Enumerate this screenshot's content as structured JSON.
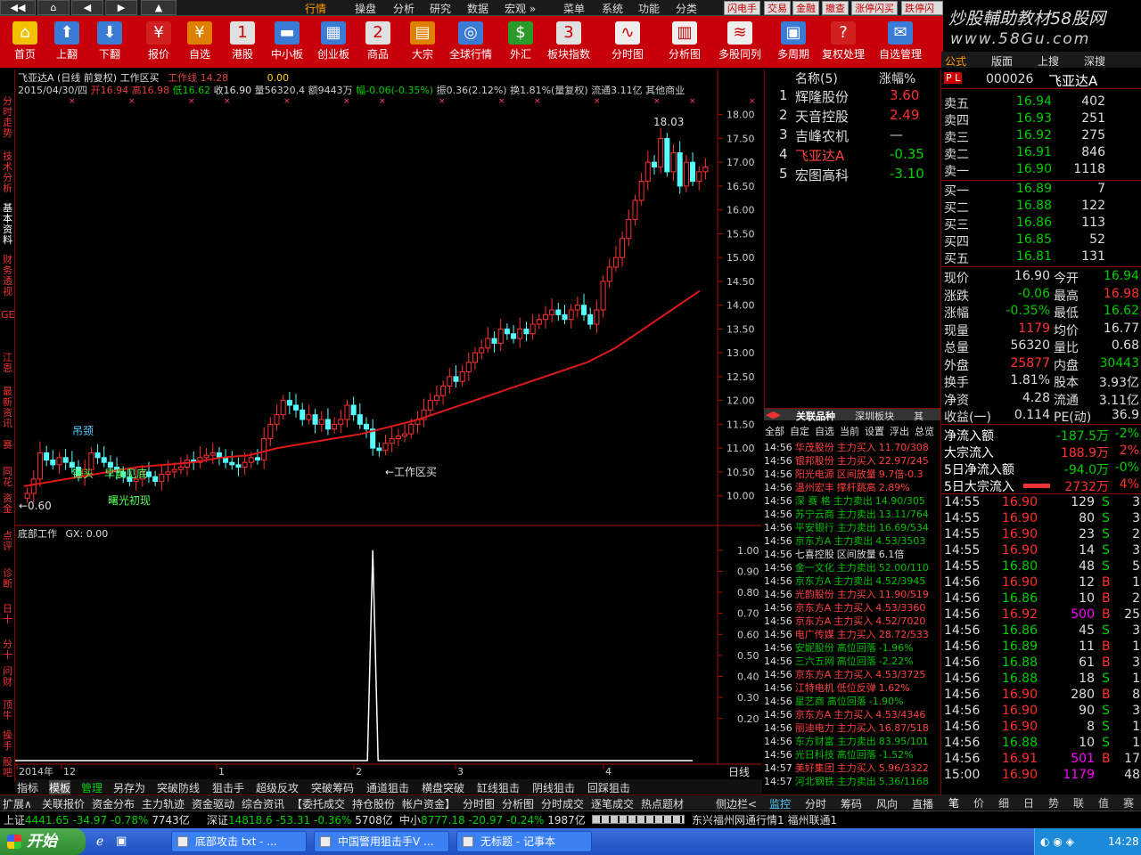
{
  "menu": {
    "items": [
      "行情",
      "操盘",
      "分析",
      "研究",
      "数据",
      "宏观 »",
      "菜单",
      "系统",
      "功能",
      "分类"
    ],
    "right_buttons": [
      "闪电手",
      "交易",
      "金融",
      "撤查",
      "涨停闪买",
      "跌停闪买"
    ]
  },
  "toolbar": {
    "items": [
      "首页",
      "上翻",
      "下翻",
      "报价",
      "自选",
      "港股",
      "中小板",
      "创业板",
      "商品",
      "大宗",
      "全球行情",
      "外汇",
      "板块指数",
      "分时图",
      "分析图",
      "多股同列",
      "多周期",
      "复权处理",
      "自选管理"
    ]
  },
  "brand": {
    "line1": "炒股輔助教材58股网",
    "line2": "www.58Gu.com"
  },
  "vtabs": [
    "分时走势",
    "技术分析",
    "基本资料",
    "财务透视",
    "GET",
    "江恩",
    "最新资讯",
    "赛",
    "同花",
    "资金",
    "点评",
    "诊断",
    "日十",
    "分十",
    "问财",
    "顶牛",
    "操手",
    "股吧"
  ],
  "chart": {
    "title": "飞亚达A (日线 前复权) 工作区买",
    "indicator_label": "工作线 14.28",
    "indicator_value": "0.00",
    "ohlc_line": {
      "date": "2015/04/30/四",
      "open_l": "开",
      "open": "16.94",
      "high_l": "高",
      "high": "16.98",
      "low_l": "低",
      "low": "16.62",
      "close_l": "收",
      "close": "16.90",
      "vol": "量56320.4",
      "amt": "额9443万",
      "chg": "幅-0.06(-0.35%)",
      "amp": "振0.36(2.12%)",
      "turn": "换1.81%(量复权)",
      "float": "流通3.11亿",
      "sector": "其他商业"
    },
    "annotations": [
      "吊颈",
      "锤头",
      "早晨见底",
      "曙光初现",
      "←工作区买",
      "←0.60",
      "18.03"
    ],
    "sub_title": "底部工作",
    "sub_value": "GX: 0.00",
    "x_labels": [
      "2014年",
      "12",
      "1",
      "2",
      "3",
      "4"
    ],
    "period": "日线"
  },
  "chart_data": [
    {
      "type": "candlestick",
      "title": "飞亚达A (日线 前复权) 工作区买",
      "y_ticks": [
        "18.00",
        "17.50",
        "17.00",
        "16.50",
        "16.00",
        "15.50",
        "15.00",
        "14.50",
        "14.00",
        "13.50",
        "13.00",
        "12.50",
        "12.00",
        "11.50",
        "11.00",
        "10.50",
        "10.00"
      ],
      "ylim": [
        9.6,
        18.2
      ],
      "closes": [
        10.05,
        10.35,
        10.9,
        10.75,
        10.65,
        10.8,
        10.7,
        10.6,
        10.4,
        10.55,
        10.9,
        10.8,
        10.7,
        10.6,
        10.5,
        10.4,
        10.3,
        10.35,
        10.5,
        10.4,
        10.3,
        10.45,
        10.5,
        10.55,
        10.6,
        10.75,
        10.7,
        10.8,
        10.85,
        10.9,
        10.8,
        10.7,
        10.65,
        10.6,
        10.7,
        10.8,
        10.75,
        11.2,
        11.5,
        11.7,
        12.0,
        11.9,
        11.8,
        11.6,
        11.7,
        11.5,
        11.6,
        11.4,
        11.5,
        11.6,
        11.9,
        11.7,
        11.5,
        11.4,
        11.0,
        10.95,
        11.1,
        11.2,
        11.25,
        11.3,
        11.5,
        11.6,
        11.8,
        12.0,
        12.1,
        12.3,
        12.5,
        12.4,
        12.6,
        12.8,
        13.0,
        13.1,
        13.3,
        13.2,
        13.5,
        13.4,
        13.3,
        13.5,
        13.4,
        13.6,
        13.7,
        13.8,
        13.9,
        13.8,
        13.7,
        13.9,
        14.0,
        13.8,
        13.6,
        13.9,
        14.5,
        14.8,
        15.0,
        15.4,
        15.8,
        16.2,
        16.6,
        17.0,
        16.9,
        17.5,
        16.8,
        17.2,
        16.5,
        17.0,
        16.6,
        16.8,
        16.9
      ],
      "ma": [
        10.2,
        10.3,
        10.4,
        10.5,
        10.6,
        10.65,
        10.7,
        10.8,
        10.85,
        11.0,
        11.1,
        11.2,
        11.3,
        11.45,
        11.6,
        11.8,
        12.0,
        12.2,
        12.4,
        12.6,
        12.8,
        13.1,
        13.5,
        13.9,
        14.3
      ],
      "ma_color": "#e01818"
    },
    {
      "type": "line",
      "title": "底部工作",
      "y_ticks": [
        "1.00",
        "0.90",
        "0.80",
        "0.70",
        "0.60",
        "0.50",
        "0.40",
        "0.30",
        "0.20"
      ],
      "ylim": [
        0,
        1.05
      ],
      "signal_index": 54,
      "signal_value": 1.0
    }
  ],
  "stocklist": {
    "header_name": "名称(5)",
    "header_chg": "涨幅%",
    "rows": [
      {
        "no": "1",
        "name": "辉隆股份",
        "chg": "3.60",
        "color": "#ff3030"
      },
      {
        "no": "2",
        "name": "天音控股",
        "chg": "2.49",
        "color": "#ff3030"
      },
      {
        "no": "3",
        "name": "吉峰农机",
        "chg": "—",
        "color": "#cccccc"
      },
      {
        "no": "4",
        "name": "飞亚达A",
        "chg": "-0.35",
        "color": "#00d000"
      },
      {
        "no": "5",
        "name": "宏图高科",
        "chg": "-3.10",
        "color": "#00d000"
      }
    ]
  },
  "tape_tabs": [
    "关联品种",
    "深圳板块",
    "其"
  ],
  "tape_filters": [
    "全部",
    "自定",
    "自选",
    "当前",
    "设置",
    "浮出",
    "总览"
  ],
  "tape": [
    [
      "14:56",
      "华茂股份",
      "主力买入",
      "11.70/308",
      "#ff4040"
    ],
    [
      "14:56",
      "银邦股份",
      "主力买入",
      "22.97/245",
      "#ff4040"
    ],
    [
      "14:56",
      "阳光电源",
      "区间放量",
      "9.7倍-0.3",
      "#ff4040"
    ],
    [
      "14:56",
      "温州宏丰",
      "撑杆跳高",
      "2.89%",
      "#ff4040"
    ],
    [
      "14:56",
      "深 赛 格",
      "主力卖出",
      "14.90/305",
      "#00c000"
    ],
    [
      "14:56",
      "苏宁云商",
      "主力卖出",
      "13.11/764",
      "#00c000"
    ],
    [
      "14:56",
      "平安银行",
      "主力卖出",
      "16.69/534",
      "#00c000"
    ],
    [
      "14:56",
      "京东方A",
      "主力卖出",
      "4.53/3503",
      "#00c000"
    ],
    [
      "14:56",
      "七喜控股",
      "区间放量",
      "6.1倍",
      "#dddddd"
    ],
    [
      "14:56",
      "金一文化",
      "主力卖出",
      "52.00/110",
      "#00c000"
    ],
    [
      "14:56",
      "京东方A",
      "主力卖出",
      "4.52/3945",
      "#00c000"
    ],
    [
      "14:56",
      "光韵股份",
      "主力买入",
      "11.90/519",
      "#ff4040"
    ],
    [
      "14:56",
      "京东方A",
      "主力买入",
      "4.53/3360",
      "#ff4040"
    ],
    [
      "14:56",
      "京东方A",
      "主力买入",
      "4.52/7020",
      "#ff4040"
    ],
    [
      "14:56",
      "电广传媒",
      "主力买入",
      "28.72/533",
      "#ff4040"
    ],
    [
      "14:56",
      "安妮股份",
      "高位回落",
      "-1.96%",
      "#00c000"
    ],
    [
      "14:56",
      "三六五网",
      "高位回落",
      "-2.22%",
      "#00c000"
    ],
    [
      "14:56",
      "京东方A",
      "主力买入",
      "4.53/3725",
      "#ff4040"
    ],
    [
      "14:56",
      "江特电机",
      "低位反弹",
      "1.62%",
      "#ff4040"
    ],
    [
      "14:56",
      "星艺商",
      "高位回落",
      "-1.90%",
      "#00c000"
    ],
    [
      "14:56",
      "京东方A",
      "主力买入",
      "4.53/4346",
      "#ff4040"
    ],
    [
      "14:56",
      "丽迪电力",
      "主力买入",
      "16.87/518",
      "#ff4040"
    ],
    [
      "14:56",
      "东方财富",
      "主力卖出",
      "83.95/101",
      "#00c000"
    ],
    [
      "14:56",
      "光日科技",
      "高位回落",
      "-1.52%",
      "#00c000"
    ],
    [
      "14:57",
      "美好集团",
      "主力买入",
      "5.96/3322",
      "#ff4040"
    ],
    [
      "14:57",
      "河北钢铁",
      "主力卖出",
      "5.36/1168",
      "#00c000"
    ]
  ],
  "quote": {
    "tabs": [
      "公式",
      "版面",
      "上搜",
      "深搜"
    ],
    "code": "000026",
    "name": "飞亚达A",
    "asks": [
      [
        "卖五",
        "16.94",
        "402"
      ],
      [
        "卖四",
        "16.93",
        "251"
      ],
      [
        "卖三",
        "16.92",
        "275"
      ],
      [
        "卖二",
        "16.91",
        "846"
      ],
      [
        "卖一",
        "16.90",
        "1118"
      ]
    ],
    "bids": [
      [
        "买一",
        "16.89",
        "7"
      ],
      [
        "买二",
        "16.88",
        "122"
      ],
      [
        "买三",
        "16.86",
        "113"
      ],
      [
        "买四",
        "16.85",
        "52"
      ],
      [
        "买五",
        "16.81",
        "131"
      ]
    ],
    "stats": [
      [
        "现价",
        "16.90",
        "今开",
        "16.94"
      ],
      [
        "涨跌",
        "-0.06",
        "最高",
        "16.98"
      ],
      [
        "涨幅",
        "-0.35%",
        "最低",
        "16.62"
      ],
      [
        "现量",
        "1179",
        "均价",
        "16.77"
      ],
      [
        "总量",
        "56320",
        "量比",
        "0.68"
      ],
      [
        "外盘",
        "25877",
        "内盘",
        "30443"
      ],
      [
        "换手",
        "1.81%",
        "股本",
        "3.93亿"
      ],
      [
        "净资",
        "4.28",
        "流通",
        "3.11亿"
      ],
      [
        "收益(一)",
        "0.114",
        "PE(动)",
        "36.9"
      ]
    ],
    "flows": [
      [
        "净流入额",
        "-187.5万",
        "-2%"
      ],
      [
        "大宗流入",
        "188.9万",
        "2%"
      ],
      [
        "5日净流入额",
        "-94.0万",
        "-0%"
      ],
      [
        "5日大宗流入",
        "2732万",
        "4%"
      ]
    ],
    "ticks": [
      [
        "14:55",
        "16.90",
        "129",
        "S",
        "3"
      ],
      [
        "14:55",
        "16.90",
        "80",
        "S",
        "3"
      ],
      [
        "14:55",
        "16.90",
        "23",
        "S",
        "2"
      ],
      [
        "14:55",
        "16.90",
        "14",
        "S",
        "3"
      ],
      [
        "14:55",
        "16.80",
        "48",
        "S",
        "5"
      ],
      [
        "14:56",
        "16.90",
        "12",
        "B",
        "1"
      ],
      [
        "14:56",
        "16.86",
        "10",
        "B",
        "2"
      ],
      [
        "14:56",
        "16.92",
        "500",
        "B",
        "25"
      ],
      [
        "14:56",
        "16.86",
        "45",
        "S",
        "3"
      ],
      [
        "14:56",
        "16.89",
        "11",
        "B",
        "1"
      ],
      [
        "14:56",
        "16.88",
        "61",
        "B",
        "3"
      ],
      [
        "14:56",
        "16.88",
        "18",
        "S",
        "1"
      ],
      [
        "14:56",
        "16.90",
        "280",
        "B",
        "8"
      ],
      [
        "14:56",
        "16.90",
        "90",
        "S",
        "3"
      ],
      [
        "14:56",
        "16.90",
        "8",
        "S",
        "1"
      ],
      [
        "14:56",
        "16.88",
        "10",
        "S",
        "1"
      ],
      [
        "14:56",
        "16.91",
        "501",
        "B",
        "17"
      ],
      [
        "15:00",
        "16.90",
        "1179",
        "",
        "48"
      ]
    ],
    "bottom_tabs": [
      "笔",
      "价",
      "细",
      "日",
      "势",
      "联",
      "值",
      "赛"
    ]
  },
  "indicator_tabs": [
    "指标",
    "模板",
    "管理",
    "另存为",
    "突破防线",
    "狙击手",
    "超级反攻",
    "突破筹码",
    "通道狙击",
    "横盘突破",
    "缸线狙击",
    "阴线狙击",
    "回踩狙击"
  ],
  "func_tabs": [
    "扩展∧",
    "关联报价",
    "资金分布",
    "主力轨迹",
    "资金驱动",
    "综合资讯",
    "【委托成交",
    "持仓股份",
    "帐户资金】",
    "分时图",
    "分析图",
    "分时成交",
    "逐笔成交",
    "热点题材",
    "",
    "侧边栏<"
  ],
  "right_func_tabs": [
    "监控",
    "分时",
    "筹码",
    "风向",
    "直播"
  ],
  "index_bar": {
    "sh": "上证",
    "sh_v": "4441.65",
    "sh_c": "-34.97",
    "sh_p": "-0.78%",
    "sh_a": "7743亿",
    "sz": "深证",
    "sz_v": "14818.6",
    "sz_c": "-53.31",
    "sz_p": "-0.36%",
    "sz_a": "5708亿",
    "zx": "中小",
    "zx_v": "8777.18",
    "zx_c": "-20.97",
    "zx_p": "-0.24%",
    "zx_a": "1987亿",
    "news": "东兴福州网通行情1  福州联通1"
  },
  "taskbar": {
    "start": "开始",
    "windows": [
      "底部攻击 txt - ...",
      "中国警用狙击手V ...",
      "无标题 - 记事本"
    ],
    "clock": "14:28"
  }
}
